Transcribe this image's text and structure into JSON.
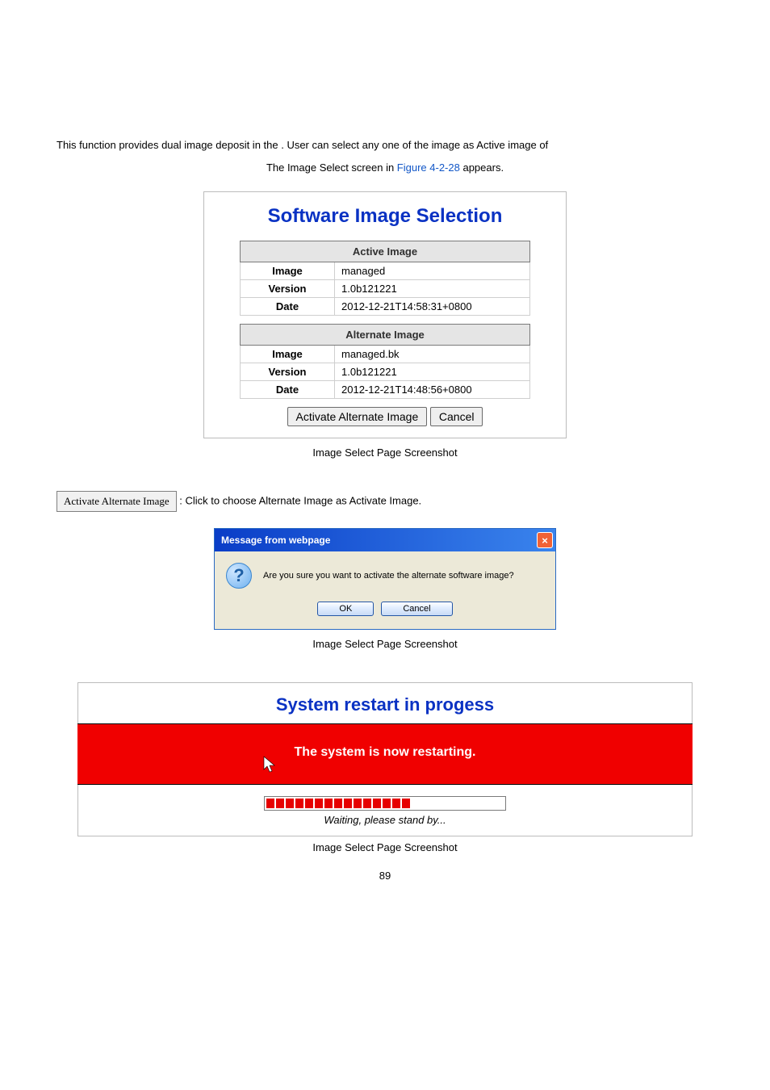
{
  "intro": {
    "line1_a": "This function provides dual image deposit in the ",
    "line1_b": ". User can select any one of the image as Active image of",
    "line2_a": "The Image Select screen in ",
    "line2_ref": "Figure 4-2-28",
    "line2_b": " appears."
  },
  "swi": {
    "title": "Software Image Selection",
    "active_header": "Active Image",
    "alt_header": "Alternate Image",
    "labels": {
      "image": "Image",
      "version": "Version",
      "date": "Date"
    },
    "active": {
      "image": "managed",
      "version": "1.0b121221",
      "date": "2012-12-21T14:58:31+0800"
    },
    "alternate": {
      "image": "managed.bk",
      "version": "1.0b121221",
      "date": "2012-12-21T14:48:56+0800"
    },
    "btn_activate": "Activate Alternate Image",
    "btn_cancel": "Cancel"
  },
  "caption": "Image Select Page Screenshot",
  "doc": {
    "btn_label": "Activate Alternate Image",
    "btn_desc": ": Click to choose Alternate Image as Activate Image."
  },
  "msgbox": {
    "title": "Message from webpage",
    "close": "×",
    "qmark": "?",
    "question": "Are you sure you want to activate the alternate software image?",
    "ok": "OK",
    "cancel": "Cancel"
  },
  "restart": {
    "title": "System restart in progess",
    "red_msg": "The system is now restarting.",
    "waiting": "Waiting, please stand by..."
  },
  "pageno": "89"
}
